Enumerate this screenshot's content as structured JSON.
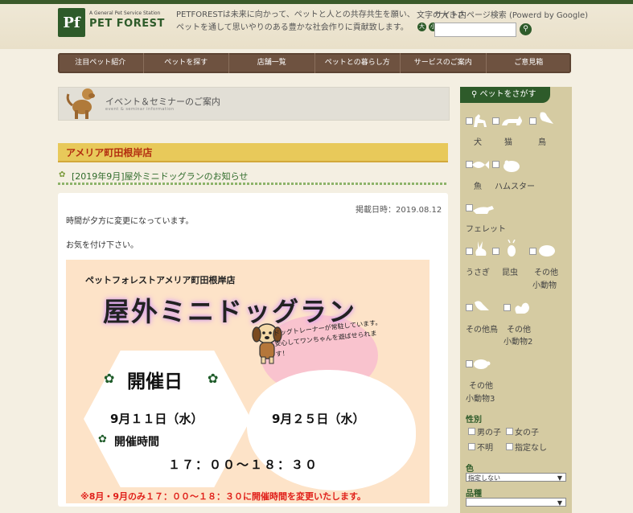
{
  "header": {
    "logo_mark": "Pf",
    "logo_tagline": "A General Pet Service Station",
    "logo_name": "PET FOREST",
    "tagline": "PETFORESTは未来に向かって、ペットと人との共存共生を願い、ペットを通して思いやりのある豊かな社会作りに貢献致します。",
    "font_size_label": "文字の大きさ",
    "font_buttons": [
      "大",
      "小"
    ],
    "search_label": "サイト内ページ検索 (Powerd by Google)",
    "search_value": "",
    "search_icon": "search-icon"
  },
  "nav": {
    "items": [
      "注目ペット紹介",
      "ペットを探す",
      "店舗一覧",
      "ペットとの暮らし方",
      "サービスのご案内",
      "ご意見箱"
    ]
  },
  "event": {
    "title": "イベント＆セミナーのご案内",
    "subtitle": "event & seminar information"
  },
  "store": {
    "name": "アメリア町田根岸店"
  },
  "post": {
    "title": "[2019年9月]屋外ミニドッグランのお知らせ",
    "date": "掲載日時：2019.08.12",
    "body1": "時間が夕方に変更になっています。",
    "body2": "お気を付け下さい。"
  },
  "flyer": {
    "store": "ペットフォレストアメリア町田根岸店",
    "main": "屋外ミニドッグラン",
    "note": "ドッグトレーナーが常駐しています。安心してワンちゃんを遊ばせられます！",
    "kaisai": "開催日",
    "date1": "9月１１日（水）",
    "date2": "9月２５日（水）",
    "time_label": "開催時間",
    "time": "１７：００〜１８：３０",
    "notice": "※8月・9月のみ１７：００〜１８：３０に開催時間を変更いたします。"
  },
  "sidebar": {
    "header": "ペットをさがす",
    "animals": {
      "dog": "犬",
      "cat": "猫",
      "bird": "鳥",
      "fish": "魚",
      "hamster": "ハムスター",
      "ferret": "フェレット",
      "rabbit": "うさぎ",
      "insect": "昆虫",
      "other_small": "その他",
      "other_small2": "小動物",
      "other_bird": "その他鳥",
      "other_small_b": "その他",
      "other_small_b2": "小動物2",
      "other_small_c": "その他",
      "other_small_c2": "小動物3"
    },
    "gender_label": "性別",
    "gender": [
      "男の子",
      "女の子",
      "不明",
      "指定なし"
    ],
    "color_label": "色",
    "color_value": "指定しない",
    "breed_label": "品種"
  },
  "colors": {
    "brand_green": "#2e5b2a",
    "nav_brown": "#6e5240",
    "store_red": "#b32e10"
  }
}
